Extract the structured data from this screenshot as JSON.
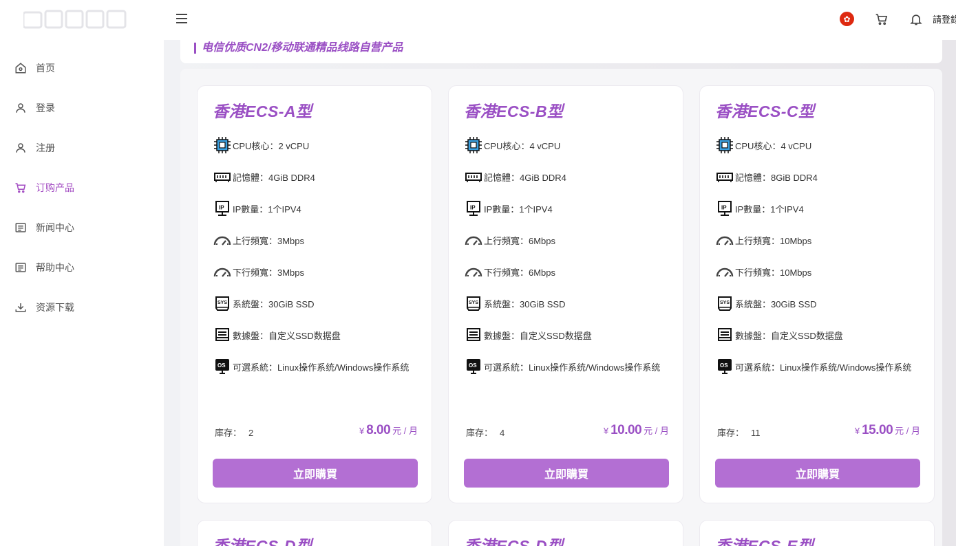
{
  "header": {
    "login_text": "請登錄"
  },
  "sidebar": {
    "items": [
      {
        "label": "首页",
        "icon": "home-icon"
      },
      {
        "label": "登录",
        "icon": "user-icon"
      },
      {
        "label": "注册",
        "icon": "user-icon"
      },
      {
        "label": "订购产品",
        "icon": "cart-icon",
        "active": true
      },
      {
        "label": "新闻中心",
        "icon": "document-icon"
      },
      {
        "label": "帮助中心",
        "icon": "document-icon"
      },
      {
        "label": "资源下载",
        "icon": "download-icon"
      }
    ]
  },
  "banner": {
    "text": "电信优质CN2/移动联通精品线路自营产品"
  },
  "products": [
    {
      "title": "香港ECS-A型",
      "specs": [
        "CPU核心：2 vCPU",
        "記憶體：4GiB DDR4",
        "IP數量：1个IPV4",
        "上行頻寬：3Mbps",
        "下行頻寬：3Mbps",
        "系統盤：30GiB SSD",
        "數據盤：自定义SSD数据盘",
        "可選系統：Linux操作系统/Windows操作系统"
      ],
      "stock_label": "庫存：",
      "stock": "2",
      "currency": "¥",
      "price": "8.00",
      "unit": "元 / 月",
      "buy": "立即購買"
    },
    {
      "title": "香港ECS-B型",
      "specs": [
        "CPU核心：4 vCPU",
        "記憶體：4GiB DDR4",
        "IP數量：1个IPV4",
        "上行頻寬：6Mbps",
        "下行頻寬：6Mbps",
        "系統盤：30GiB SSD",
        "數據盤：自定义SSD数据盘",
        "可選系統：Linux操作系统/Windows操作系统"
      ],
      "stock_label": "庫存：",
      "stock": "4",
      "currency": "¥",
      "price": "10.00",
      "unit": "元 / 月",
      "buy": "立即購買"
    },
    {
      "title": "香港ECS-C型",
      "specs": [
        "CPU核心：4 vCPU",
        "記憶體：8GiB DDR4",
        "IP數量：1个IPV4",
        "上行頻寬：10Mbps",
        "下行頻寬：10Mbps",
        "系統盤：30GiB SSD",
        "數據盤：自定义SSD数据盘",
        "可選系統：Linux操作系统/Windows操作系统"
      ],
      "stock_label": "庫存：",
      "stock": "11",
      "currency": "¥",
      "price": "15.00",
      "unit": "元 / 月",
      "buy": "立即購買"
    }
  ],
  "next_row_titles": [
    "香港ECS-D型",
    "香港ECS-D型",
    "香港ECS-E型"
  ],
  "spec_icons": [
    "cpu-icon",
    "memory-icon",
    "ip-icon",
    "upload-speed-icon",
    "download-speed-icon",
    "system-disk-icon",
    "data-disk-icon",
    "os-icon"
  ],
  "colors": {
    "accent": "#9a4fc4",
    "button": "#b36fd3"
  }
}
